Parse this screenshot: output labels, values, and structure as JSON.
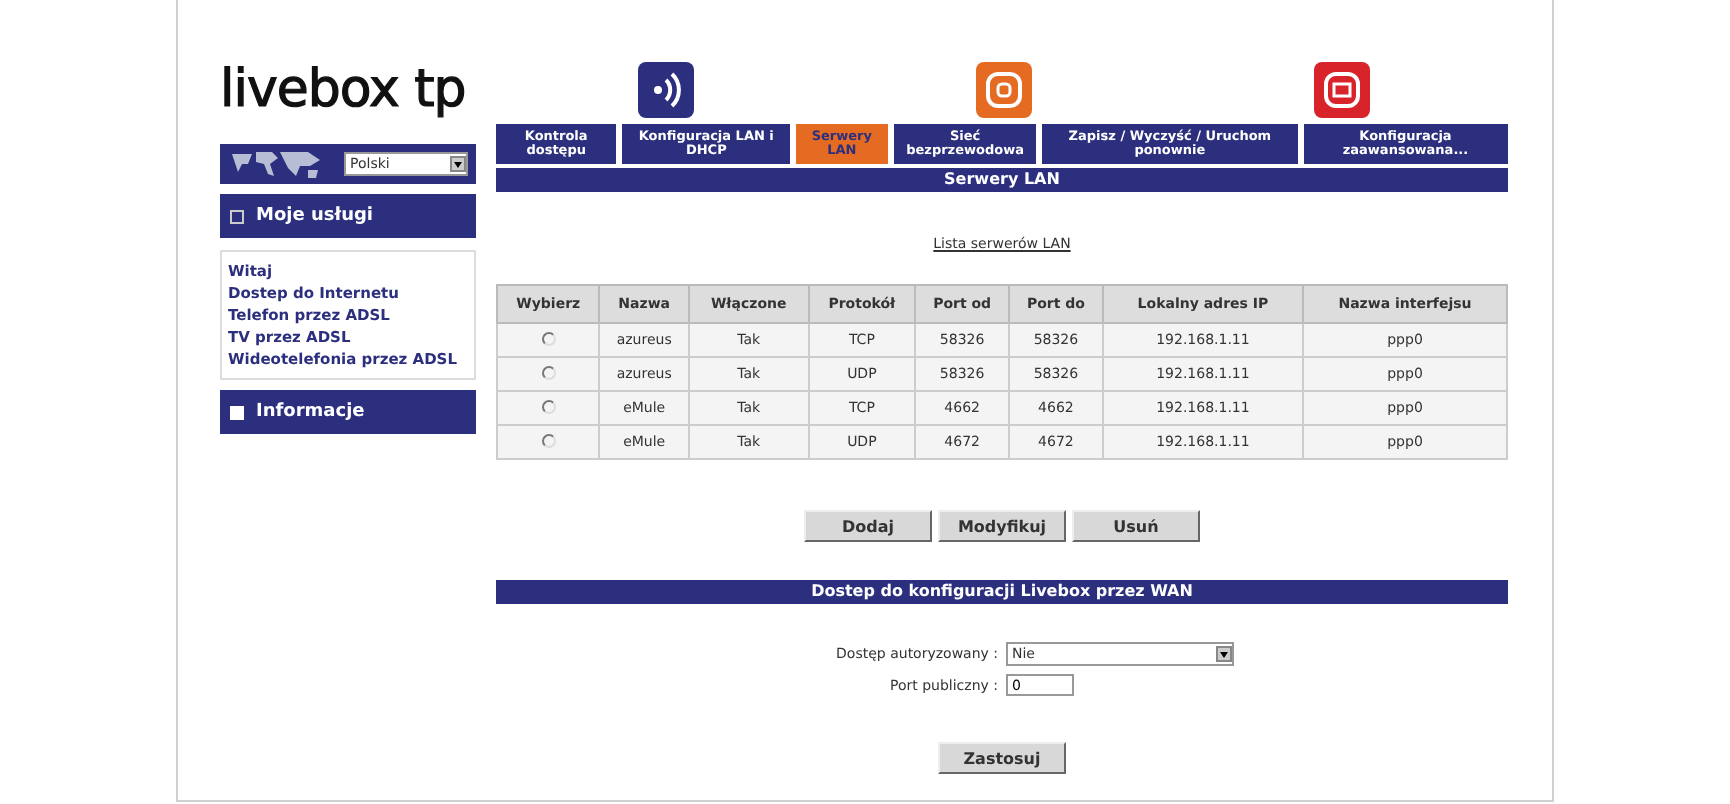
{
  "logo": "livebox tp",
  "language": {
    "value": "Polski"
  },
  "sidebar": [
    {
      "title": "Moje usługi",
      "expanded": true,
      "items": [
        "Witaj",
        "Dostep do Internetu",
        "Telefon przez ADSL",
        "TV przez ADSL",
        "Wideotelefonia przez ADSL"
      ]
    },
    {
      "title": "Informacje",
      "expanded": false
    }
  ],
  "tabs": [
    {
      "label": "Kontrola dostępu",
      "selected": false
    },
    {
      "label": "Konfiguracja LAN i DHCP",
      "selected": false
    },
    {
      "label": "Serwery LAN",
      "selected": true
    },
    {
      "label": "Sieć bezprzewodowa",
      "selected": false
    },
    {
      "label": "Zapisz / Wyczyść / Uruchom ponownie",
      "selected": false
    },
    {
      "label": "Konfiguracja zaawansowana...",
      "selected": false
    }
  ],
  "section_title": "Serwery LAN",
  "list_link": "Lista serwerów LAN",
  "table": {
    "columns": [
      "Wybierz",
      "Nazwa",
      "Włączone",
      "Protokół",
      "Port od",
      "Port do",
      "Lokalny adres IP",
      "Nazwa interfejsu"
    ],
    "rows": [
      {
        "selected": false,
        "cells": [
          "",
          "azureus",
          "Tak",
          "TCP",
          "58326",
          "58326",
          "192.168.1.11",
          "ppp0"
        ]
      },
      {
        "selected": false,
        "cells": [
          "",
          "azureus",
          "Tak",
          "UDP",
          "58326",
          "58326",
          "192.168.1.11",
          "ppp0"
        ]
      },
      {
        "selected": false,
        "cells": [
          "",
          "eMule",
          "Tak",
          "TCP",
          "4662",
          "4662",
          "192.168.1.11",
          "ppp0"
        ]
      },
      {
        "selected": false,
        "cells": [
          "",
          "eMule",
          "Tak",
          "UDP",
          "4672",
          "4672",
          "192.168.1.11",
          "ppp0"
        ]
      }
    ]
  },
  "buttons": [
    "Dodaj",
    "Modyfikuj",
    "Usuń"
  ],
  "wan": {
    "title": "Dostep do konfiguracji Livebox przez WAN",
    "fields": [
      {
        "kind": "select",
        "label": "Dostęp autoryzowany :",
        "value": "Nie"
      },
      {
        "kind": "text",
        "label": "Port publiczny :",
        "value": "0"
      }
    ],
    "apply": "Zastosuj"
  }
}
